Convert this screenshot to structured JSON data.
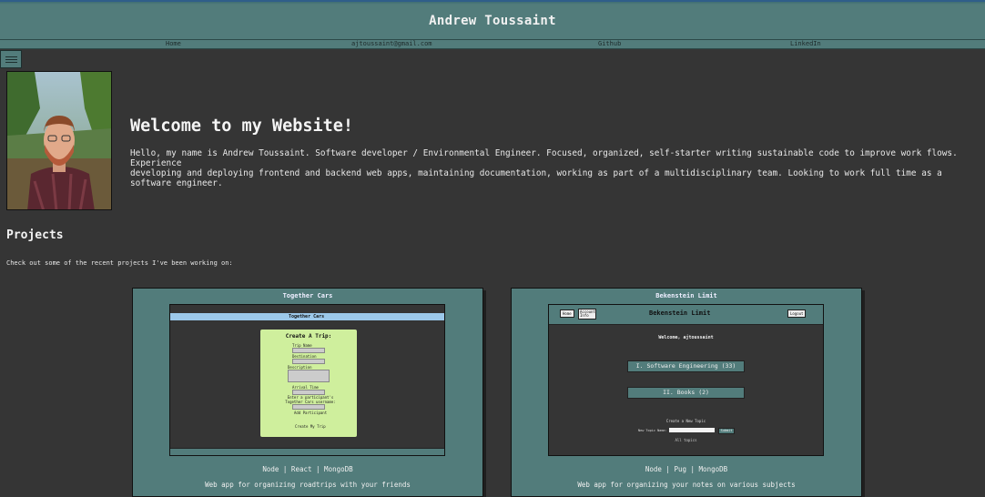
{
  "header": {
    "title": "Andrew Toussaint"
  },
  "nav": [
    {
      "label": "Home"
    },
    {
      "label": "ajtoussaint@gmail.com"
    },
    {
      "label": "Github"
    },
    {
      "label": "LinkedIn"
    }
  ],
  "hero": {
    "heading": "Welcome to my Website!",
    "bio_line1": "Hello, my name is Andrew Toussaint. Software developer / Environmental Engineer. Focused, organized, self-starter writing sustainable code to improve work flows. Experience",
    "bio_line2": "developing and deploying frontend and backend web apps, maintaining documentation, working as part of a multidisciplinary team. Looking to work full time as a software engineer."
  },
  "projects": {
    "heading": "Projects",
    "intro": "Check out some of the recent projects I've been working on:",
    "items": [
      {
        "title": "Together Cars",
        "tech": "Node | React | MongoDB",
        "description": "Web app for organizing roadtrips with your friends",
        "preview": {
          "app_title": "Together Cars",
          "form_title": "Create A Trip:",
          "fields": [
            "Trip Name",
            "Destination",
            "Description",
            "Arrival Time"
          ],
          "friends_text": "Enter a participant's Together Cars username:",
          "add_button": "Add Participant",
          "submit_button": "Create My Trip",
          "accent": "#cfef9d"
        }
      },
      {
        "title": "Bekenstein Limit",
        "tech": "Node | Pug | MongoDB",
        "description": "Web app for organizing your notes on various subjects",
        "preview": {
          "app_title": "Bekenstein Limit",
          "home_button": "Home",
          "account_button": "Account Info",
          "logout_button": "Logout",
          "welcome": "Welcome, ajtoussaint",
          "topics": [
            "I. Software Engineering (33)",
            "II. Books (2)"
          ],
          "new_topic_heading": "Create a New Topic",
          "new_topic_label": "New Topic Name:",
          "new_topic_button": "Submit",
          "all_topics": "All topics"
        }
      }
    ]
  },
  "colors": {
    "teal": "#527c7b",
    "background": "#353535"
  }
}
